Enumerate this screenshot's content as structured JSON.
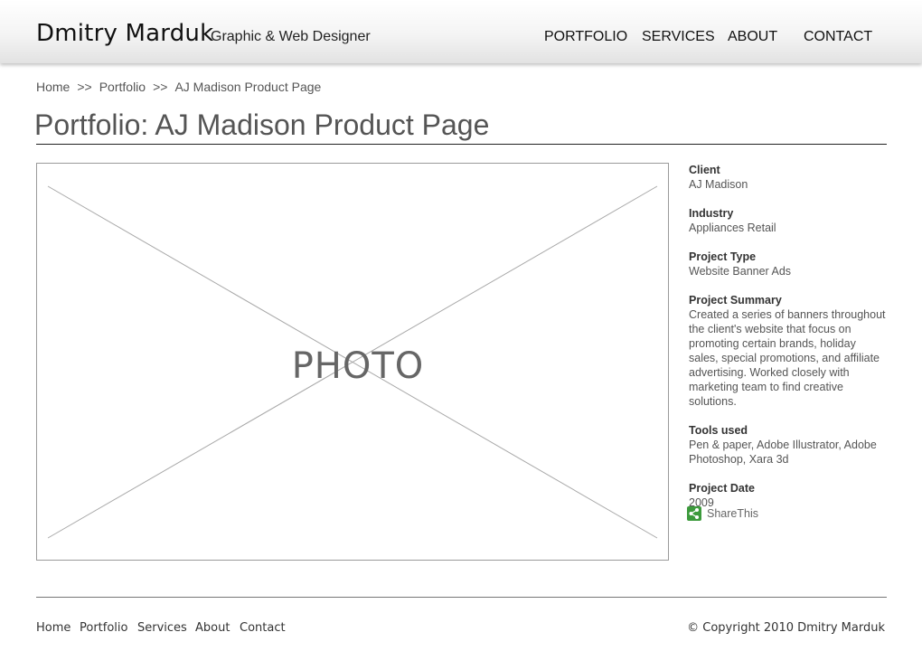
{
  "header": {
    "name": "Dmitry Marduk",
    "tagline": "Graphic & Web Designer",
    "nav": [
      "PORTFOLIO",
      "SERVICES",
      "ABOUT",
      "CONTACT"
    ]
  },
  "breadcrumb": {
    "items": [
      "Home",
      "Portfolio",
      "AJ Madison Product Page"
    ],
    "separator": ">>"
  },
  "page": {
    "title": "Portfolio: AJ Madison Product Page",
    "photo_label": "PHOTO"
  },
  "details": [
    {
      "label": "Client",
      "value": "AJ Madison"
    },
    {
      "label": "Industry",
      "value": "Appliances Retail"
    },
    {
      "label": "Project Type",
      "value": "Website Banner Ads"
    },
    {
      "label": "Project Summary",
      "value": "Created a series of banners throughout the client's website that focus on promoting certain brands, holiday sales, special promotions, and affiliate advertising. Worked closely with marketing team to find creative solutions."
    },
    {
      "label": "Tools used",
      "value": "Pen & paper, Adobe Illustrator, Adobe Photoshop, Xara 3d"
    },
    {
      "label": "Project Date",
      "value": "2009"
    }
  ],
  "share": {
    "label": "ShareThis",
    "icon": "share-icon",
    "color": "#3c9a3c"
  },
  "footer": {
    "links": [
      "Home",
      "Portfolio",
      "Services",
      "About",
      "Contact"
    ],
    "copyright": "© Copyright 2010 Dmitry Marduk"
  }
}
